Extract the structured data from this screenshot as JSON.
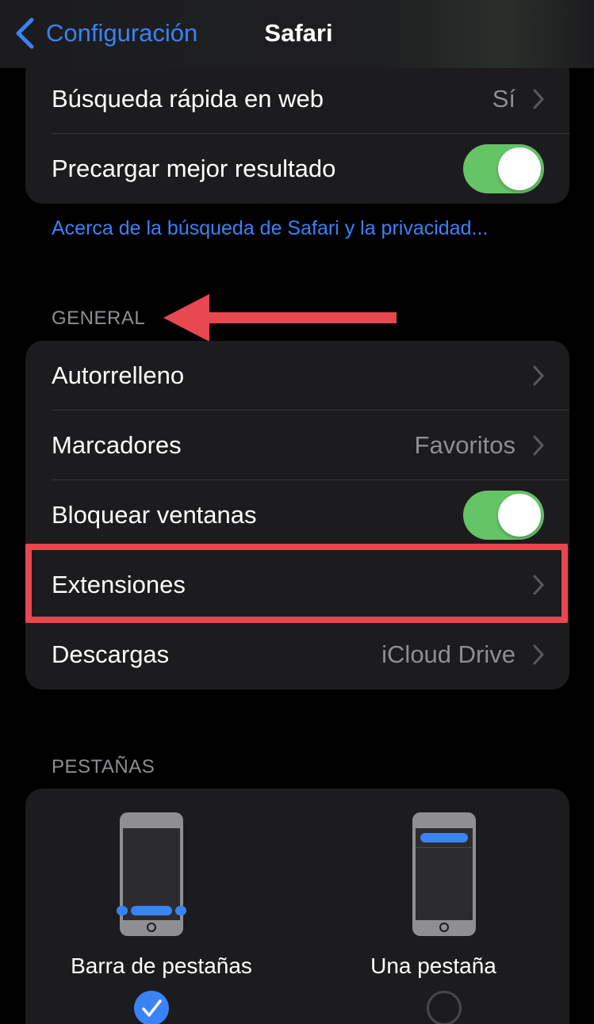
{
  "nav": {
    "back_label": "Configuración",
    "title": "Safari"
  },
  "search_group": {
    "quick_search": {
      "label": "Búsqueda rápida en web",
      "value": "Sí"
    },
    "preload": {
      "label": "Precargar mejor resultado",
      "toggle_on": true
    }
  },
  "privacy_link": "Acerca de la búsqueda de Safari y la privacidad...",
  "general": {
    "header": "GENERAL",
    "items": [
      {
        "label": "Autorrelleno",
        "value": ""
      },
      {
        "label": "Marcadores",
        "value": "Favoritos"
      },
      {
        "label": "Bloquear ventanas",
        "toggle_on": true
      },
      {
        "label": "Extensiones",
        "value": ""
      },
      {
        "label": "Descargas",
        "value": "iCloud Drive"
      }
    ]
  },
  "tabs": {
    "header": "PESTAÑAS",
    "options": [
      {
        "label": "Barra de pestañas",
        "selected": true
      },
      {
        "label": "Una pestaña",
        "selected": false
      }
    ]
  },
  "colors": {
    "accent": "#3a82f7",
    "toggle_on": "#65c466",
    "annotation": "#e8474f",
    "row_bg": "#1c1c1e",
    "secondary_text": "#8e8e93"
  },
  "icons": {
    "back": "chevron-left-icon",
    "disclosure": "chevron-right-icon",
    "check": "checkmark-icon"
  }
}
